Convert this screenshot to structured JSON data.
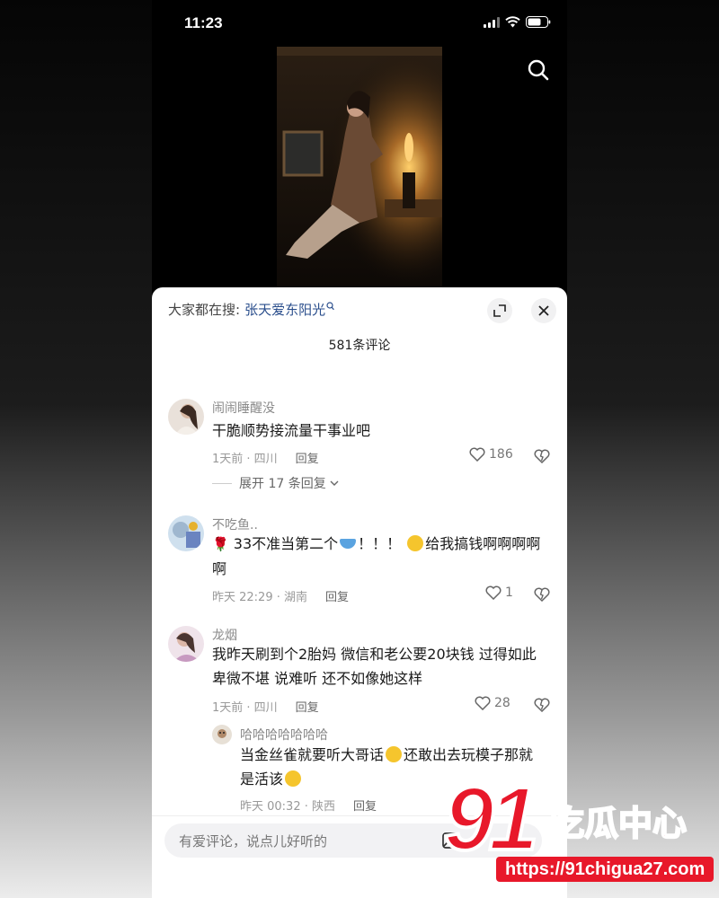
{
  "status": {
    "time": "11:23"
  },
  "header": {
    "hot_prefix": "大家都在搜:",
    "hot_query": "张天爱东阳光",
    "comment_count": "581条评论"
  },
  "comments": [
    {
      "username": "闹闹睡醒没",
      "text": "干脆顺势接流量干事业吧",
      "time_location": "1天前 · 四川",
      "reply": "回复",
      "likes": "186",
      "expand": "展开 17 条回复"
    },
    {
      "username": "不吃鱼..",
      "text_part1": "33不准当第二个",
      "text_part2": "！！！",
      "text_part3": "给我搞钱啊啊啊啊",
      "text_line2": "啊",
      "time_location": "昨天 22:29 · 湖南",
      "reply": "回复",
      "likes": "1"
    },
    {
      "username": "龙烟",
      "text_line1": "我昨天刷到个2胎妈 微信和老公要20块钱 过得如此",
      "text_line2": "卑微不堪 说难听 还不如像她这样",
      "time_location": "1天前 · 四川",
      "reply": "回复",
      "likes": "28"
    }
  ],
  "sub_reply": {
    "username": "哈哈哈哈哈哈哈",
    "text_line1a": "当金丝雀就要听大哥话",
    "text_line1b": "还敢出去玩模子那就",
    "text_line2": "是活该",
    "time_location": "昨天 00:32 · 陕西",
    "reply": "回复"
  },
  "input": {
    "placeholder": "有爱评论，说点儿好听的"
  },
  "watermark": {
    "brand_number": "91",
    "brand_name": "吃瓜中心",
    "url": "https://91chigua27.com"
  },
  "colors": {
    "link": "#2a4e8c",
    "watermark_red": "#e8182a"
  }
}
